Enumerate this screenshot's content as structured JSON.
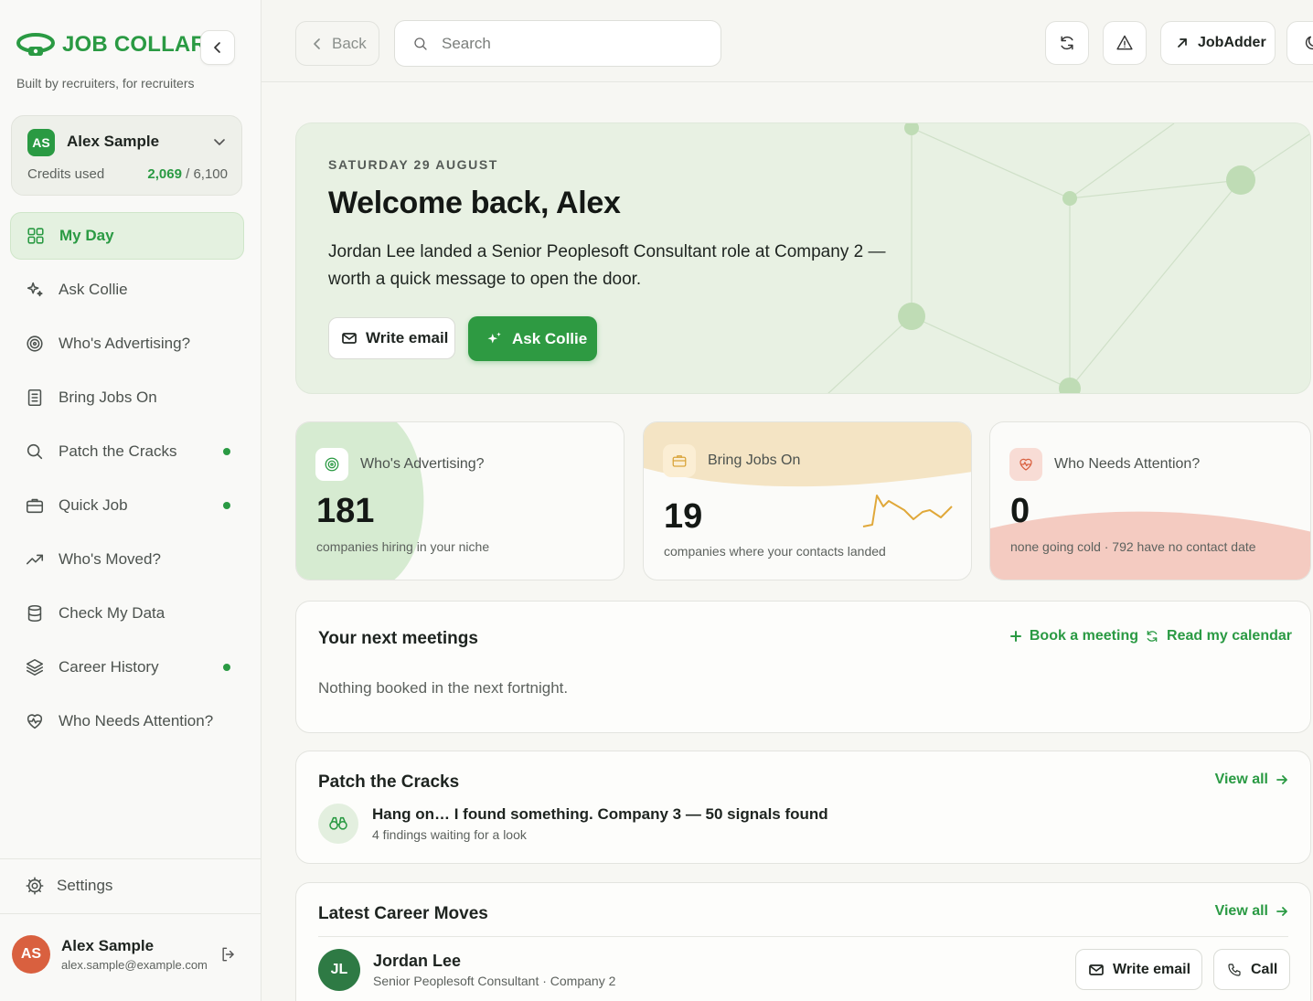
{
  "brand": {
    "name": "JOB COLLAR",
    "tagline": "Built by recruiters, for recruiters"
  },
  "account": {
    "initials": "AS",
    "name": "Alex Sample",
    "credits_label": "Credits used",
    "credits_used": "2,069",
    "credits_total": "/ 6,100"
  },
  "sidebar": {
    "items": [
      {
        "label": "My Day",
        "icon": "grid-icon",
        "active": true,
        "dot": false
      },
      {
        "label": "Ask Collie",
        "icon": "sparkle-icon",
        "active": false,
        "dot": false
      },
      {
        "label": "Who's Advertising?",
        "icon": "target-icon",
        "active": false,
        "dot": false
      },
      {
        "label": "Bring Jobs On",
        "icon": "document-icon",
        "active": false,
        "dot": false
      },
      {
        "label": "Patch the Cracks",
        "icon": "search-icon",
        "active": false,
        "dot": true
      },
      {
        "label": "Quick Job",
        "icon": "briefcase-icon",
        "active": false,
        "dot": true
      },
      {
        "label": "Who's Moved?",
        "icon": "trending-up-icon",
        "active": false,
        "dot": false
      },
      {
        "label": "Check My Data",
        "icon": "database-icon",
        "active": false,
        "dot": false
      },
      {
        "label": "Career History",
        "icon": "layers-icon",
        "active": false,
        "dot": true
      },
      {
        "label": "Who Needs Attention?",
        "icon": "heart-pulse-icon",
        "active": false,
        "dot": false
      }
    ],
    "settings_label": "Settings",
    "user": {
      "initials": "AS",
      "name": "Alex Sample",
      "email": "alex.sample@example.com"
    }
  },
  "topbar": {
    "back_label": "Back",
    "search_placeholder": "Search",
    "jobadder_label": "JobAdder"
  },
  "hero": {
    "date": "SATURDAY 29 AUGUST",
    "title": "Welcome back, Alex",
    "message": "Jordan Lee landed a Senior Peoplesoft Consultant role at Company 2 — worth a quick message to open the door.",
    "write_email_label": "Write email",
    "ask_collie_label": "Ask Collie"
  },
  "stats": [
    {
      "label": "Who's Advertising?",
      "value": "181",
      "sub": "companies hiring in your niche",
      "icon": "target-icon",
      "color": "#2a9a43"
    },
    {
      "label": "Bring Jobs On",
      "value": "19",
      "sub": "companies where your contacts landed",
      "icon": "briefcase-icon",
      "color": "#d9a43a"
    },
    {
      "label": "Who Needs Attention?",
      "value": "0",
      "sub": "none going cold · 792 have no contact date",
      "icon": "heart-pulse-icon",
      "color": "#d9603f"
    }
  ],
  "meetings": {
    "title": "Your next meetings",
    "book_label": "Book a meeting",
    "calendar_label": "Read my calendar",
    "empty_text": "Nothing booked in the next fortnight."
  },
  "patch": {
    "title": "Patch the Cracks",
    "view_all": "View all",
    "finding_title": "Hang on… I found something. Company 3 — 50 signals found",
    "finding_sub": "4 findings waiting for a look"
  },
  "career_moves": {
    "title": "Latest Career Moves",
    "view_all": "View all",
    "items": [
      {
        "initials": "JL",
        "name": "Jordan Lee",
        "detail": "Senior Peoplesoft Consultant · Company 2",
        "email_label": "Write email",
        "call_label": "Call"
      }
    ]
  },
  "colors": {
    "brand_green": "#2a9a43",
    "hero_bg": "#e8f1e3",
    "amber": "#d9a43a",
    "coral": "#d9603f"
  }
}
